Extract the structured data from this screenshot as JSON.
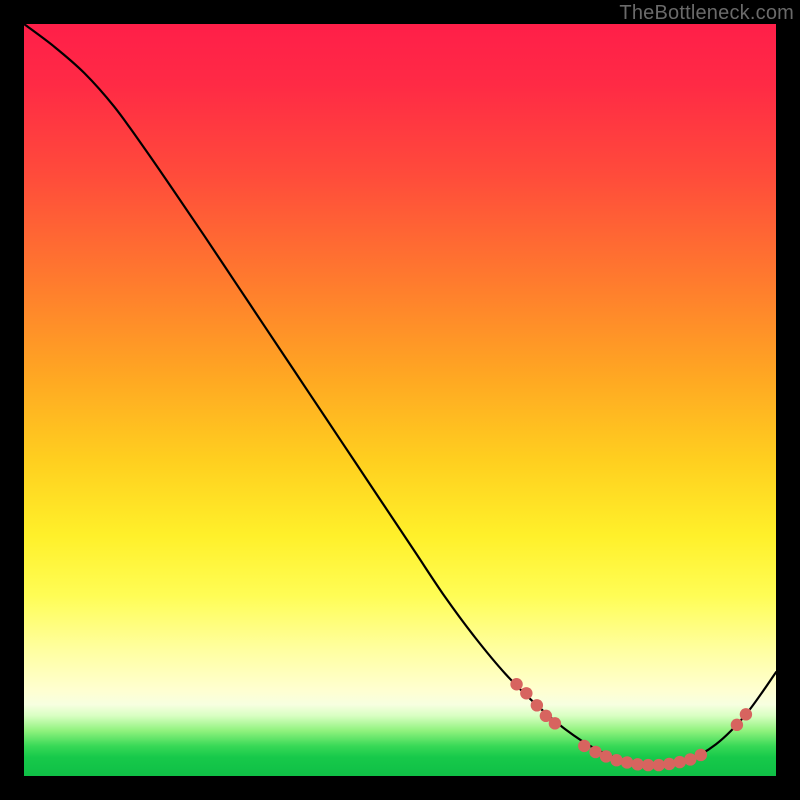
{
  "watermark": "TheBottleneck.com",
  "colors": {
    "curve": "#000000",
    "marker_fill": "#d7645f",
    "marker_stroke": "#b84d48"
  },
  "chart_data": {
    "type": "line",
    "title": "",
    "xlabel": "",
    "ylabel": "",
    "xlim": [
      0,
      100
    ],
    "ylim": [
      0,
      100
    ],
    "grid": false,
    "legend": false,
    "series": [
      {
        "name": "curve",
        "x": [
          0,
          4,
          8,
          12,
          16,
          20,
          24,
          28,
          32,
          36,
          40,
          44,
          48,
          52,
          56,
          60,
          64,
          68,
          72,
          76,
          80,
          84,
          88,
          92,
          96,
          100
        ],
        "y": [
          100,
          97,
          93.5,
          89,
          83.5,
          77.7,
          71.8,
          65.8,
          59.8,
          53.8,
          47.8,
          41.8,
          35.8,
          29.8,
          23.8,
          18.4,
          13.6,
          9.6,
          6.2,
          3.6,
          2,
          1.4,
          2,
          4.2,
          8.2,
          13.8
        ]
      }
    ],
    "markers": [
      {
        "x": 65.5,
        "y": 12.2
      },
      {
        "x": 66.8,
        "y": 11.0
      },
      {
        "x": 68.2,
        "y": 9.4
      },
      {
        "x": 69.4,
        "y": 8.0
      },
      {
        "x": 70.6,
        "y": 7.0
      },
      {
        "x": 74.5,
        "y": 4.0
      },
      {
        "x": 76.0,
        "y": 3.2
      },
      {
        "x": 77.4,
        "y": 2.6
      },
      {
        "x": 78.8,
        "y": 2.1
      },
      {
        "x": 80.2,
        "y": 1.8
      },
      {
        "x": 81.6,
        "y": 1.55
      },
      {
        "x": 83.0,
        "y": 1.45
      },
      {
        "x": 84.4,
        "y": 1.45
      },
      {
        "x": 85.8,
        "y": 1.6
      },
      {
        "x": 87.2,
        "y": 1.85
      },
      {
        "x": 88.6,
        "y": 2.2
      },
      {
        "x": 90.0,
        "y": 2.8
      },
      {
        "x": 94.8,
        "y": 6.8
      },
      {
        "x": 96.0,
        "y": 8.2
      }
    ]
  }
}
